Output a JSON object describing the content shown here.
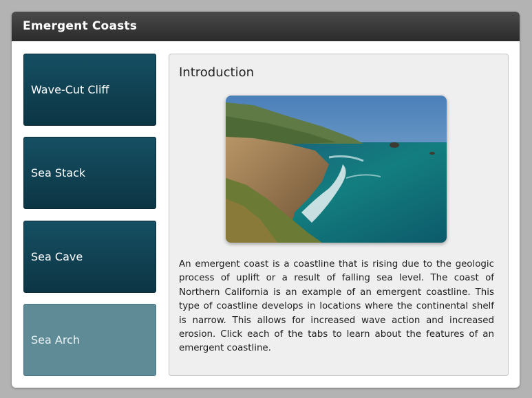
{
  "app": {
    "title": "Emergent Coasts"
  },
  "tabs": [
    {
      "label": "Wave-Cut Cliff",
      "active": false
    },
    {
      "label": "Sea Stack",
      "active": false
    },
    {
      "label": "Sea Cave",
      "active": false
    },
    {
      "label": "Sea Arch",
      "active": true
    }
  ],
  "content": {
    "heading": "Introduction",
    "image_alt": "coastline photo",
    "body": "An emergent coast is a coastline that is rising due to the geologic process of uplift or a result of falling sea level. The coast of Northern California is an example of an emergent coastline. This type of coastline develops in locations where the continental shelf is narrow. This allows for increased wave action and increased erosion. Click each of the tabs to learn about the features of an emergent coastline."
  },
  "colors": {
    "tab_bg": "#0c3544",
    "tab_active_bg": "#5f8b97",
    "titlebar_bg": "#2b2b2b"
  }
}
